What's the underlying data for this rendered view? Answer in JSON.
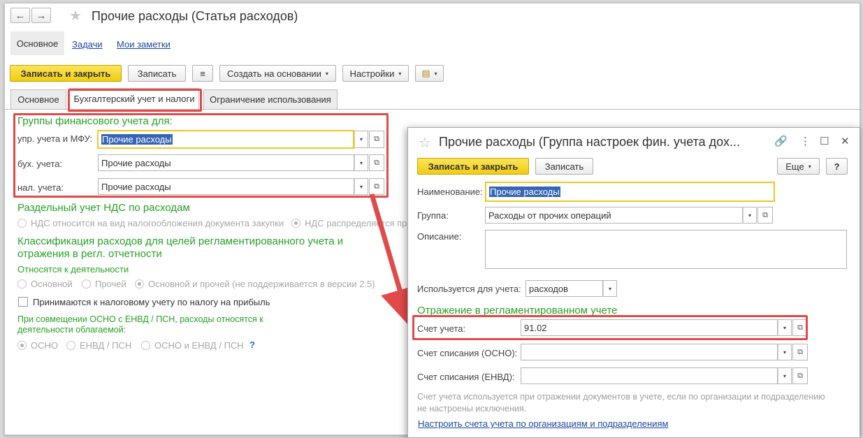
{
  "window": {
    "title": "Прочие расходы (Статья расходов)",
    "back_glyph": "←",
    "forward_glyph": "→",
    "star_glyph": "★"
  },
  "nav": {
    "current": "Основное",
    "links": [
      "Задачи",
      "Мои заметки"
    ]
  },
  "toolbar": {
    "save_close": "Записать и закрыть",
    "save": "Записать",
    "list_icon": "≡",
    "create_based": "Создать на основании",
    "settings": "Настройки",
    "report_icon": "▤",
    "caret": "▾"
  },
  "tabs": [
    "Основное",
    "Бухгалтерский учет и налоги",
    "Ограничение использования"
  ],
  "fin_groups": {
    "heading": "Группы финансового учета для:",
    "rows": [
      {
        "label": "упр. учета и МФУ:",
        "value": "Прочие расходы"
      },
      {
        "label": "бух. учета:",
        "value": "Прочие расходы"
      },
      {
        "label": "нал. учета:",
        "value": "Прочие расходы"
      }
    ],
    "dropdown_glyph": "▾",
    "open_glyph": "⧉"
  },
  "vat": {
    "heading": "Раздельный учет НДС по расходам",
    "options": [
      "НДС относится на вид налогообложения документа закупки",
      "НДС распределяется пр"
    ]
  },
  "classification": {
    "heading_line1": "Классификация расходов для целей регламентированного учета и",
    "heading_line2": "отражения в регл. отчетности",
    "activity_label": "Относятся к деятельности",
    "activity_options": [
      "Основной",
      "Прочей",
      "Основной и прочей (не поддерживается в версии 2.5)"
    ],
    "tax_checkbox": "Принимаются к налоговому учету по налогу на прибыль",
    "combo_line1": "При совмещении ОСНО с ЕНВД / ПСН, расходы относятся к",
    "combo_line2": "деятельности облагаемой:",
    "combo_options": [
      "ОСНО",
      "ЕНВД / ПСН",
      "ОСНО и ЕНВД / ПСН"
    ],
    "help": "?"
  },
  "popup": {
    "title": "Прочие расходы (Группа настроек фин. учета дох...",
    "star_glyph": "☆",
    "link_icon": "🔗",
    "more_icon": "⋮",
    "maximize_icon": "☐",
    "close_icon": "✕",
    "save_close": "Записать и закрыть",
    "save": "Записать",
    "more": "Еще",
    "help": "?",
    "name_label": "Наименование:",
    "name_value": "Прочие расходы",
    "group_label": "Группа:",
    "group_value": "Расходы от прочих операций",
    "desc_label": "Описание:",
    "used_label": "Используется для учета:",
    "used_value": "расходов",
    "reflection_heading": "Отражение в регламентированном учете",
    "account_label": "Счет учета:",
    "account_value": "91.02",
    "writeoff_osno_label": "Счет списания (ОСНО):",
    "writeoff_osno_value": "",
    "writeoff_envd_label": "Счет списания (ЕНВД):",
    "writeoff_envd_value": "",
    "note_line1": "Счет учета используется при отражении документов в учете, если по организации и подразделению",
    "note_line2": "не настроены исключения.",
    "setup_link": "Настроить счета учета по организациям и подразделениям"
  }
}
